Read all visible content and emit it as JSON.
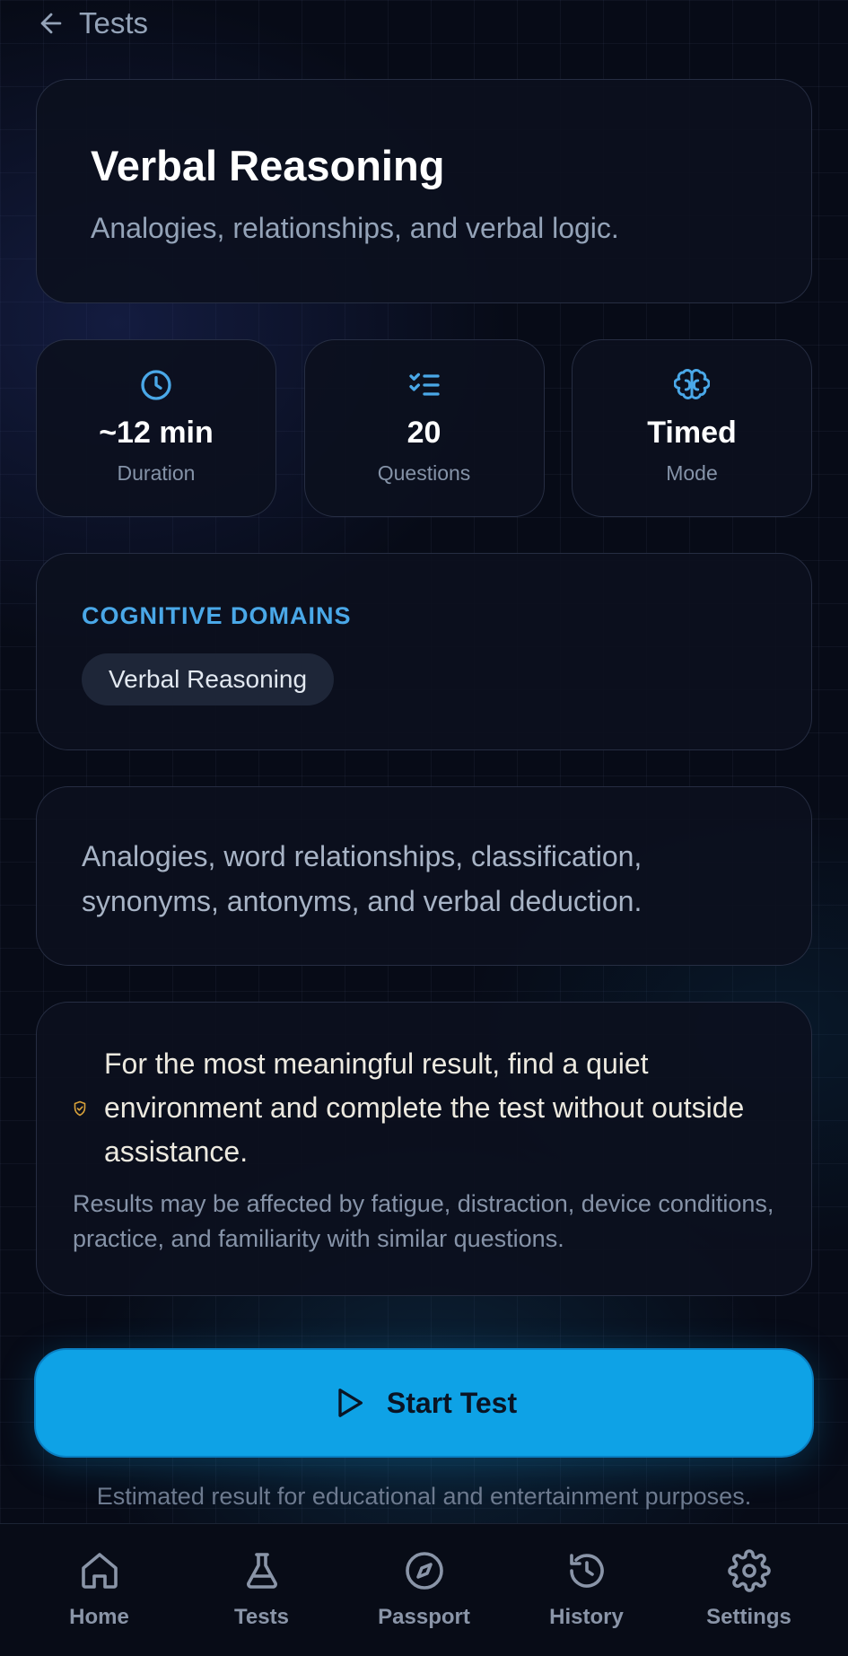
{
  "header": {
    "back_label": "Tests"
  },
  "test": {
    "title": "Verbal Reasoning",
    "subtitle": "Analogies, relationships, and verbal logic."
  },
  "stats": [
    {
      "icon": "clock-icon",
      "value": "~12 min",
      "label": "Duration"
    },
    {
      "icon": "checklist-icon",
      "value": "20",
      "label": "Questions"
    },
    {
      "icon": "brain-icon",
      "value": "Timed",
      "label": "Mode"
    }
  ],
  "domains": {
    "heading": "COGNITIVE DOMAINS",
    "chips": [
      "Verbal Reasoning"
    ]
  },
  "description": "Analogies, word relationships, classification, synonyms, antonyms, and verbal deduction.",
  "notice": {
    "icon": "shield-icon",
    "main": "For the most meaningful result, find a quiet environment and complete the test without outside assistance.",
    "sub": "Results may be affected by fatigue, distraction, device conditions, practice, and familiarity with similar questions."
  },
  "start_button": {
    "icon": "play-icon",
    "label": "Start Test"
  },
  "disclaimer": "Estimated result for educational and entertainment purposes.",
  "nav": [
    {
      "icon": "home-icon",
      "label": "Home"
    },
    {
      "icon": "flask-icon",
      "label": "Tests"
    },
    {
      "icon": "compass-icon",
      "label": "Passport"
    },
    {
      "icon": "history-icon",
      "label": "History"
    },
    {
      "icon": "gear-icon",
      "label": "Settings"
    }
  ],
  "colors": {
    "accent": "#0ea2e6",
    "icon_blue": "#4aa8e8",
    "warning": "#d9a23a",
    "background": "#070b17"
  }
}
